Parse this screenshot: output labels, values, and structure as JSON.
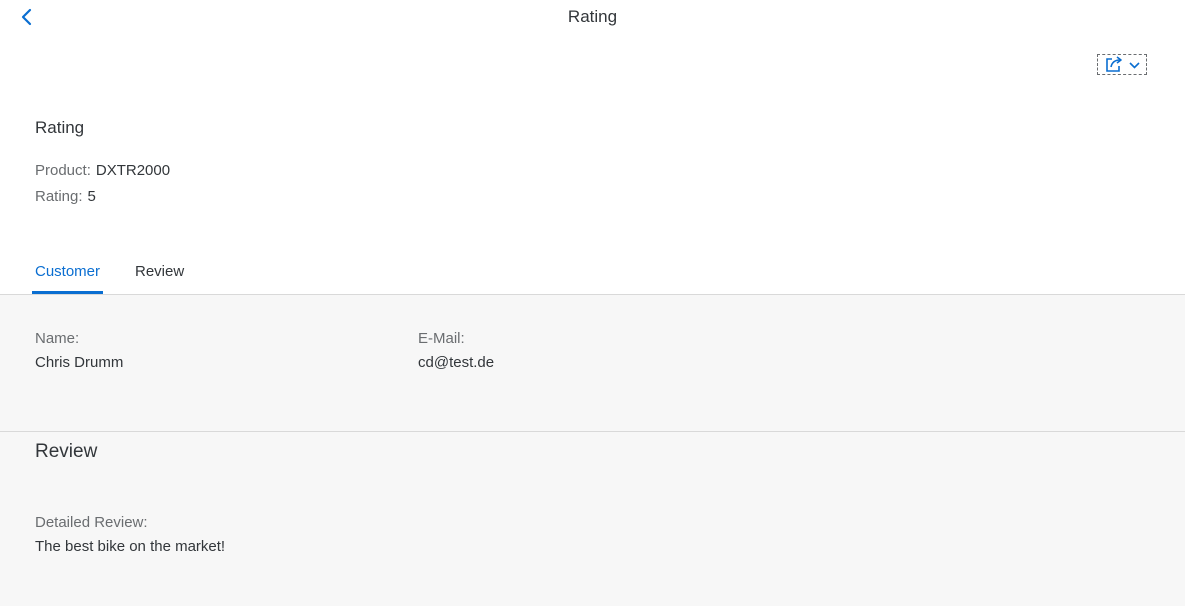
{
  "shell": {
    "title": "Rating",
    "back_icon": "chevron-left-icon",
    "share_icon": "share-icon",
    "share_caret_icon": "chevron-down-icon"
  },
  "header": {
    "title": "Rating",
    "attributes": [
      {
        "label": "Product:",
        "value": "DXTR2000"
      },
      {
        "label": "Rating:",
        "value": "5"
      }
    ]
  },
  "tabs": [
    {
      "label": "Customer",
      "active": true
    },
    {
      "label": "Review",
      "active": false
    }
  ],
  "customer": {
    "name_label": "Name:",
    "name_value": "Chris Drumm",
    "email_label": "E-Mail:",
    "email_value": "cd@test.de"
  },
  "review": {
    "title": "Review",
    "detail_label": "Detailed Review:",
    "detail_value": "The best bike on the market!"
  },
  "colors": {
    "accent": "#0a6ed1",
    "text": "#32363a",
    "label": "#6a6d70",
    "content_bg": "#f7f7f7"
  }
}
